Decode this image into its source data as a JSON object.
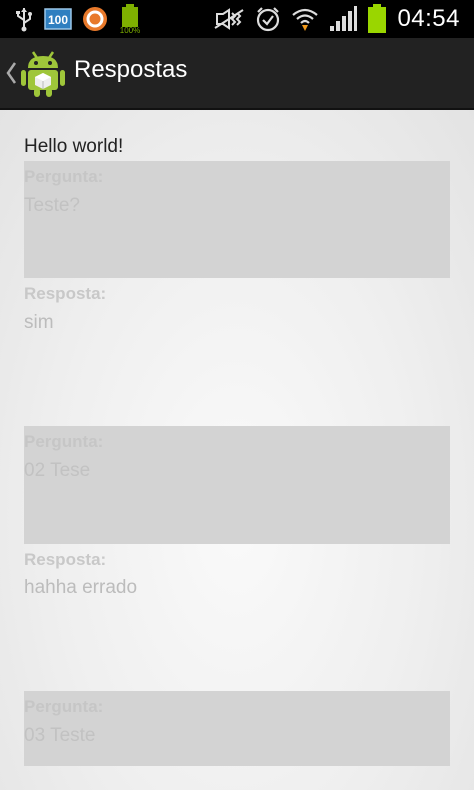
{
  "status_bar": {
    "time": "04:54",
    "notification_100_label": "100",
    "battery_small_label": "100%",
    "icons": [
      "usb-icon",
      "notification-100-icon",
      "sync-app-icon",
      "battery-small-icon",
      "mute-icon",
      "alarm-icon",
      "wifi-icon",
      "signal-icon",
      "battery-icon"
    ],
    "battery_color": "#9ad600"
  },
  "action_bar": {
    "title": "Respostas",
    "app_icon": "android-icon"
  },
  "content": {
    "hello": "Hello world!",
    "items": [
      {
        "question_label": "Pergunta:",
        "question": "Teste?",
        "answer_label": "Resposta:",
        "answer": "sim"
      },
      {
        "question_label": "Pergunta:",
        "question": "02 Tese",
        "answer_label": "Resposta:",
        "answer": "hahha errado"
      },
      {
        "question_label": "Pergunta:",
        "question": "03 Teste"
      }
    ]
  }
}
